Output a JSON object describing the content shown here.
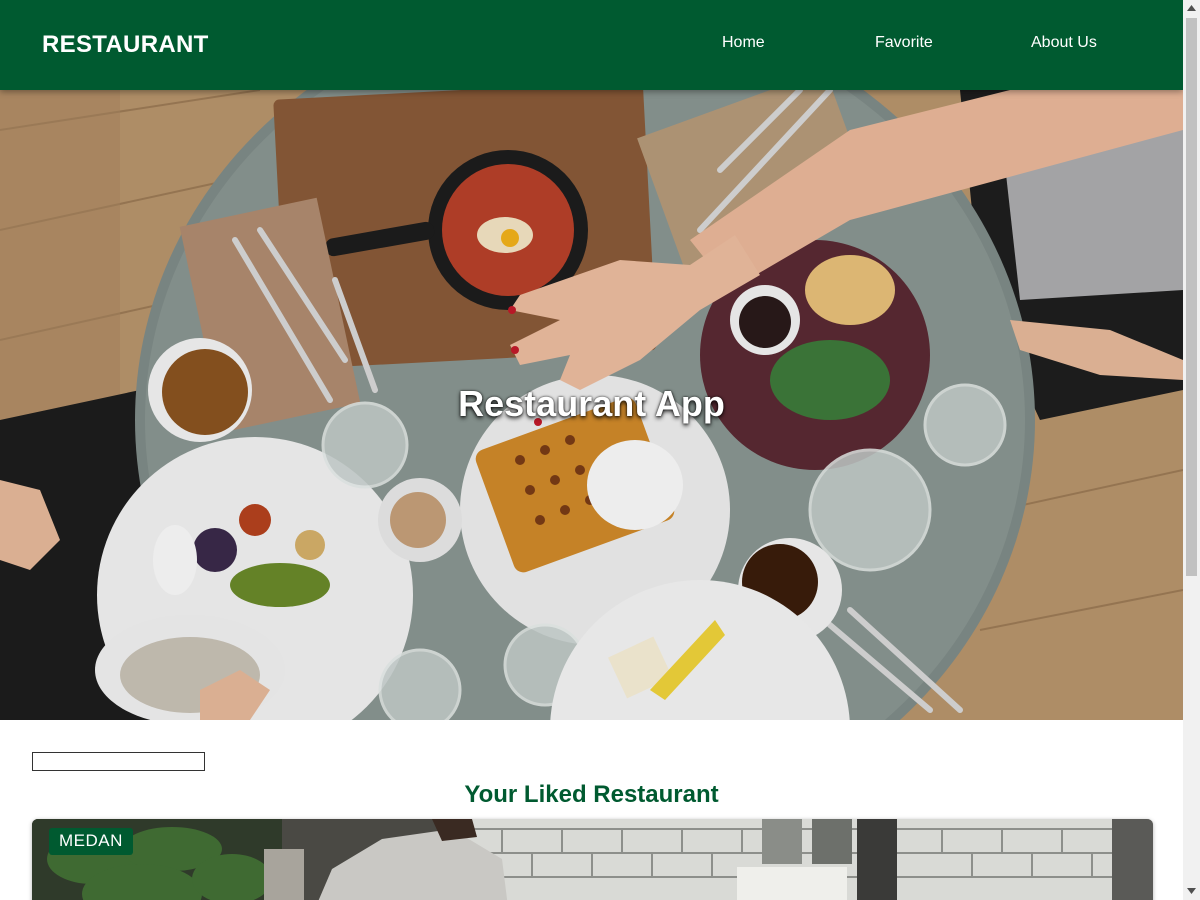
{
  "header": {
    "brand": "RESTAURANT",
    "nav": [
      {
        "label": "Home"
      },
      {
        "label": "Favorite"
      },
      {
        "label": "About Us"
      }
    ]
  },
  "hero": {
    "title": "Restaurant App"
  },
  "search": {
    "value": "",
    "placeholder": ""
  },
  "liked_section": {
    "title": "Your Liked Restaurant",
    "cards": [
      {
        "city": "MEDAN"
      }
    ]
  },
  "colors": {
    "primary": "#005a30",
    "on_primary": "#ffffff"
  },
  "icons": {
    "scroll_up": "chevron-up-icon",
    "scroll_down": "chevron-down-icon"
  }
}
